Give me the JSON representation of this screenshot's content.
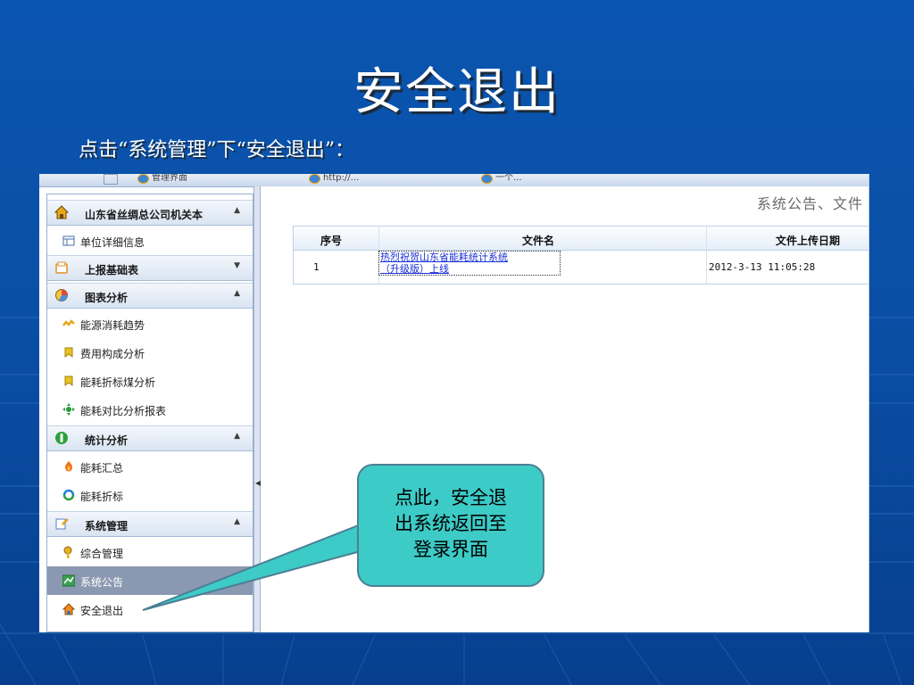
{
  "slide": {
    "title": "安全退出",
    "subtitle": "点击“系统管理”下“安全退出”："
  },
  "browser": {
    "tabs": [
      "管理界面",
      "http://...",
      "一个..."
    ]
  },
  "sidebar": {
    "sections": [
      {
        "label": "山东省丝绸总公司机关本",
        "icon": "home-icon",
        "arrow": "▲",
        "items": [
          {
            "label": "单位详细信息",
            "icon": "table-icon"
          }
        ]
      },
      {
        "label": "上报基础表",
        "icon": "folder-icon",
        "arrow": "▼",
        "items": []
      },
      {
        "label": "图表分析",
        "icon": "pie-chart-icon",
        "arrow": "▲",
        "items": [
          {
            "label": "能源消耗趋势",
            "icon": "trend-icon"
          },
          {
            "label": "费用构成分析",
            "icon": "cost-icon"
          },
          {
            "label": "能耗折标煤分析",
            "icon": "coal-icon"
          },
          {
            "label": "能耗对比分析报表",
            "icon": "compare-icon"
          }
        ]
      },
      {
        "label": "统计分析",
        "icon": "stats-icon",
        "arrow": "▲",
        "items": [
          {
            "label": "能耗汇总",
            "icon": "summary-icon"
          },
          {
            "label": "能耗折标",
            "icon": "convert-icon"
          }
        ]
      },
      {
        "label": "系统管理",
        "icon": "settings-icon",
        "arrow": "▲",
        "items": [
          {
            "label": "综合管理",
            "icon": "key-icon"
          },
          {
            "label": "系统公告",
            "icon": "notice-icon",
            "selected": true
          },
          {
            "label": "安全退出",
            "icon": "logout-icon"
          }
        ]
      }
    ]
  },
  "content": {
    "title": "系统公告、文件",
    "columns": [
      "序号",
      "文件名",
      "文件上传日期"
    ],
    "rows": [
      {
        "index": "1",
        "filename": "热烈祝贺山东省能耗统计系统（升级版）上线",
        "filename_line1": "热烈祝贺山东省能耗统计系统",
        "filename_line2": "（升级版）上线",
        "date": "2012-3-13 11:05:28"
      }
    ]
  },
  "callout": {
    "text": "点此，安全退\n出系统返回至\n登录界面"
  },
  "colors": {
    "background": "#0a4fa6",
    "callout": "#3dcbc7",
    "selected_item": "#8a99b1",
    "link": "#1a2ed8"
  }
}
